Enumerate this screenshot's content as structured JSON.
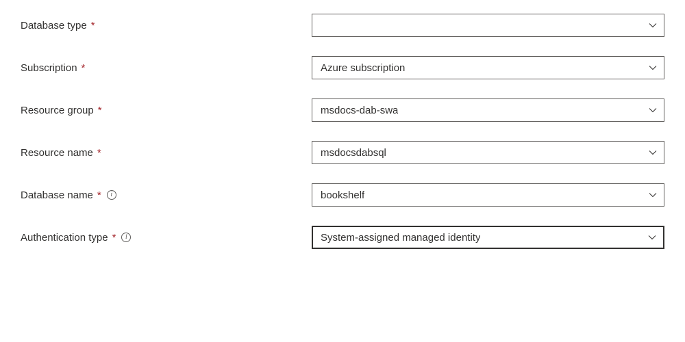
{
  "form": {
    "databaseType": {
      "label": "Database type",
      "required": "*",
      "value": ""
    },
    "subscription": {
      "label": "Subscription",
      "required": "*",
      "value": "Azure subscription"
    },
    "resourceGroup": {
      "label": "Resource group",
      "required": "*",
      "value": "msdocs-dab-swa"
    },
    "resourceName": {
      "label": "Resource name",
      "required": "*",
      "value": "msdocsdabsql"
    },
    "databaseName": {
      "label": "Database name",
      "required": "*",
      "value": "bookshelf"
    },
    "authenticationType": {
      "label": "Authentication type",
      "required": "*",
      "value": "System-assigned managed identity"
    }
  }
}
